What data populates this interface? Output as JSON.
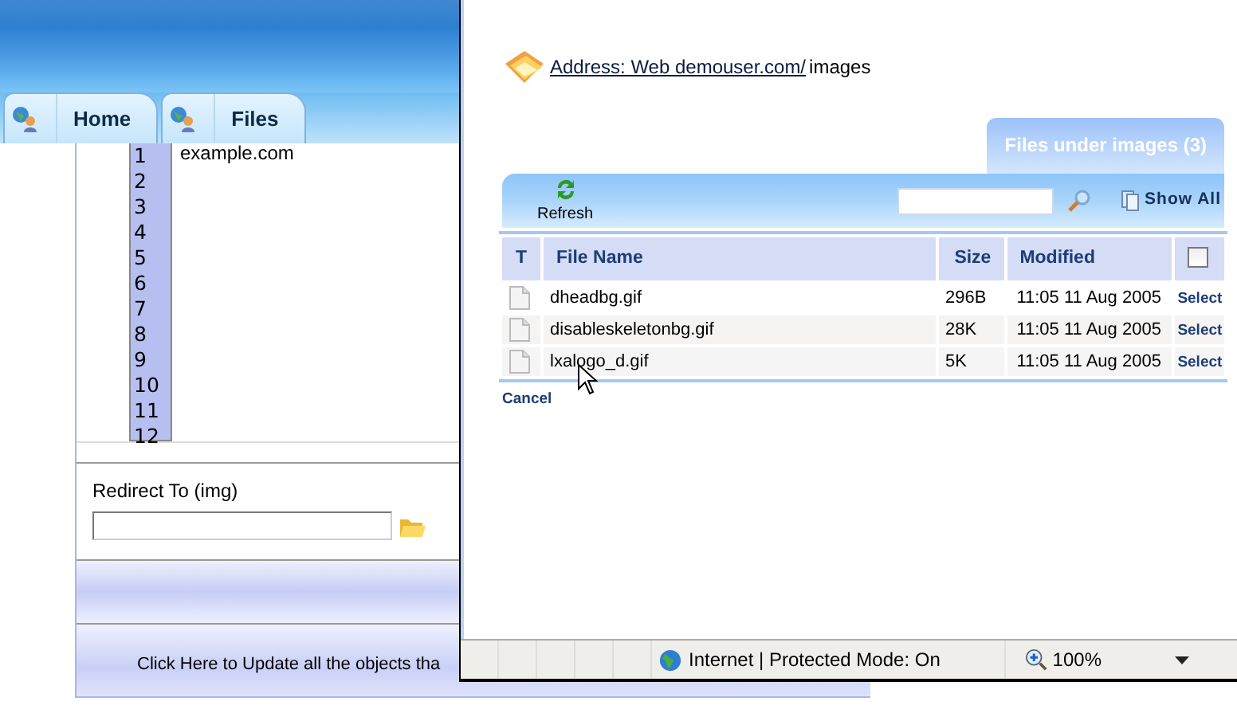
{
  "background_window": {
    "tabs": [
      {
        "label": "Home"
      },
      {
        "label": "Files"
      }
    ],
    "editor": {
      "text": "example.com",
      "line_numbers": [
        "1",
        "2",
        "3",
        "4",
        "5",
        "6",
        "7",
        "8",
        "9",
        "10",
        "11",
        "12"
      ]
    },
    "redirect_field": {
      "label": "Redirect To (img)"
    },
    "update_link": "Click Here to Update all the objects tha"
  },
  "popup_window": {
    "address": {
      "link": "Address: Web demouser.com/",
      "path": "images"
    },
    "panel_tab": "Files under images (3)",
    "toolbar": {
      "refresh": "Refresh",
      "show_all": "Show All"
    },
    "table": {
      "columns": [
        "T",
        "File Name",
        "Size",
        "Modified"
      ],
      "select_all_checked": false,
      "rows": [
        {
          "name": "dheadbg.gif",
          "size": "296B",
          "modified": "11:05 11 Aug 2005",
          "action": "Select"
        },
        {
          "name": "disableskeletonbg.gif",
          "size": "28K",
          "modified": "11:05 11 Aug 2005",
          "action": "Select"
        },
        {
          "name": "lxalogo_d.gif",
          "size": "5K",
          "modified": "11:05 11 Aug 2005",
          "action": "Select"
        }
      ]
    },
    "cancel": "Cancel",
    "status_bar": {
      "zone": "Internet | Protected Mode: On",
      "zoom": "100%"
    }
  }
}
